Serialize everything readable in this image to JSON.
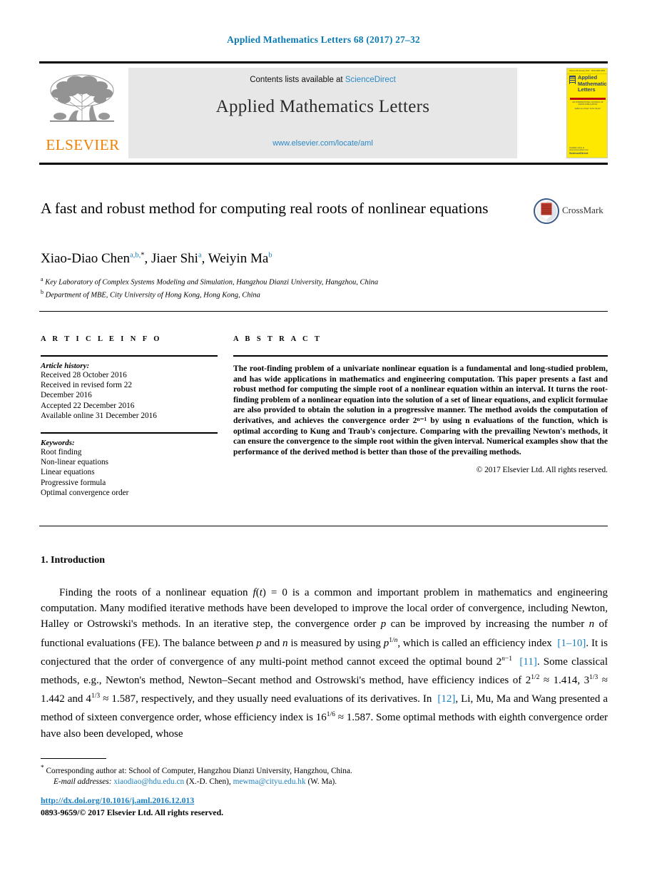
{
  "running_head": "Applied Mathematics Letters 68 (2017) 27–32",
  "masthead": {
    "contents_prefix": "Contents lists available at ",
    "sciencedirect": "ScienceDirect",
    "journal_name": "Applied Mathematics Letters",
    "url": "www.elsevier.com/locate/aml",
    "publisher_logo_text": "ELSEVIER",
    "cover": {
      "title_line1": "Applied",
      "title_line2": "Mathematics",
      "title_line3": "Letters",
      "top_left": "Volume 68 January 2017",
      "top_right": "ISSN 0893-9659",
      "subtitle": "AN INTERNATIONAL JOURNAL OF RAPID PUBLICATION",
      "editor": "Editor-in-Chief: John Taylor",
      "foot_line1": "Available online at www.sciencedirect.com",
      "foot_line2": "ScienceDirect"
    }
  },
  "article": {
    "title": "A fast and robust method for computing real roots of nonlinear equations",
    "crossmark_label": "CrossMark",
    "authors": [
      {
        "name": "Xiao-Diao Chen",
        "marks": "a,b,",
        "star": "*"
      },
      {
        "name": "Jiaer Shi",
        "marks": "a",
        "star": ""
      },
      {
        "name": "Weiyin Ma",
        "marks": "b",
        "star": ""
      }
    ],
    "affiliations": [
      {
        "mark": "a",
        "text": "Key Laboratory of Complex Systems Modeling and Simulation, Hangzhou Dianzi University, Hangzhou, China"
      },
      {
        "mark": "b",
        "text": "Department of MBE, City University of Hong Kong, Hong Kong, China"
      }
    ]
  },
  "info": {
    "heading": "A R T I C L E   I N F O",
    "history_label": "Article history:",
    "history": [
      "Received 28 October 2016",
      "Received in revised form 22",
      "December 2016",
      "Accepted 22 December 2016",
      "Available online 31 December 2016"
    ],
    "keywords_label": "Keywords:",
    "keywords": [
      "Root finding",
      "Non-linear equations",
      "Linear equations",
      "Progressive formula",
      "Optimal convergence order"
    ]
  },
  "abstract": {
    "heading": "A B S T R A C T",
    "text": "The root-finding problem of a univariate nonlinear equation is a fundamental and long-studied problem, and has wide applications in mathematics and engineering computation. This paper presents a fast and robust method for computing the simple root of a nonlinear equation within an interval. It turns the root-finding problem of a nonlinear equation into the solution of a set of linear equations, and explicit formulae are also provided to obtain the solution in a progressive manner. The method avoids the computation of derivatives, and achieves the convergence order 2ⁿ⁻¹ by using n evaluations of the function, which is optimal according to Kung and Traub's conjecture. Comparing with the prevailing Newton's methods, it can ensure the convergence to the simple root within the given interval. Numerical examples show that the performance of the derived method is better than those of the prevailing methods.",
    "copyright": "© 2017 Elsevier Ltd. All rights reserved."
  },
  "section": {
    "number_title": "1.  Introduction",
    "paragraph_html": "Finding the roots of a nonlinear equation <i>f</i>(<i>t</i>) = 0 is a common and important problem in mathematics and engineering computation. Many modified iterative methods have been developed to improve the local order of convergence, including Newton, Halley or Ostrowski's methods. In an iterative step, the convergence order <i>p</i> can be improved by increasing the number <i>n</i> of functional evaluations (FE). The balance between <i>p</i> and <i>n</i> is measured by using <i>p</i><sup class=\"exp\">1/<i>n</i></sup>, which is called an efficiency index &nbsp;<span class=\"ref\">[1–10]</span>. It is conjectured that the order of convergence of any multi-point method cannot exceed the optimal bound 2<sup class=\"exp\"><i>n</i>−1</sup> &nbsp;<span class=\"ref\">[11]</span>. Some classical methods, e.g., Newton's method, Newton–Secant method and Ostrowski's method, have efficiency indices of 2<sup class=\"exp\">1/2</sup> ≈ 1.414, 3<sup class=\"exp\">1/3</sup> ≈ 1.442 and 4<sup class=\"exp\">1/3</sup> ≈ 1.587, respectively, and they usually need evaluations of its derivatives. In &nbsp;<span class=\"ref\">[12]</span>, Li, Mu, Ma and Wang presented a method of sixteen convergence order, whose efficiency index is 16<sup class=\"exp\">1/6</sup> ≈ 1.587. Some optimal methods with eighth convergence order have also been developed, whose"
  },
  "footnotes": {
    "corresponding_html": "<sup>*</sup> Corresponding author at: School of Computer, Hangzhou Dianzi University, Hangzhou, China.",
    "email_label": "E-mail addresses:",
    "email1": "xiaodiao@hdu.edu.cn",
    "email1_name": "(X.-D. Chen),",
    "email2": "mewma@cityu.edu.hk",
    "email2_name": "(W. Ma)."
  },
  "footer": {
    "doi": "http://dx.doi.org/10.1016/j.aml.2016.12.013",
    "issn_line": "0893-9659/© 2017 Elsevier Ltd. All rights reserved."
  },
  "colors": {
    "link_blue": "#1a7fc1",
    "running_head_blue": "#0b7ab5",
    "elsevier_orange": "#f08000",
    "cover_yellow": "#ffe800",
    "cover_navy": "#2a3f77",
    "masthead_gray": "#e7e7e7"
  }
}
